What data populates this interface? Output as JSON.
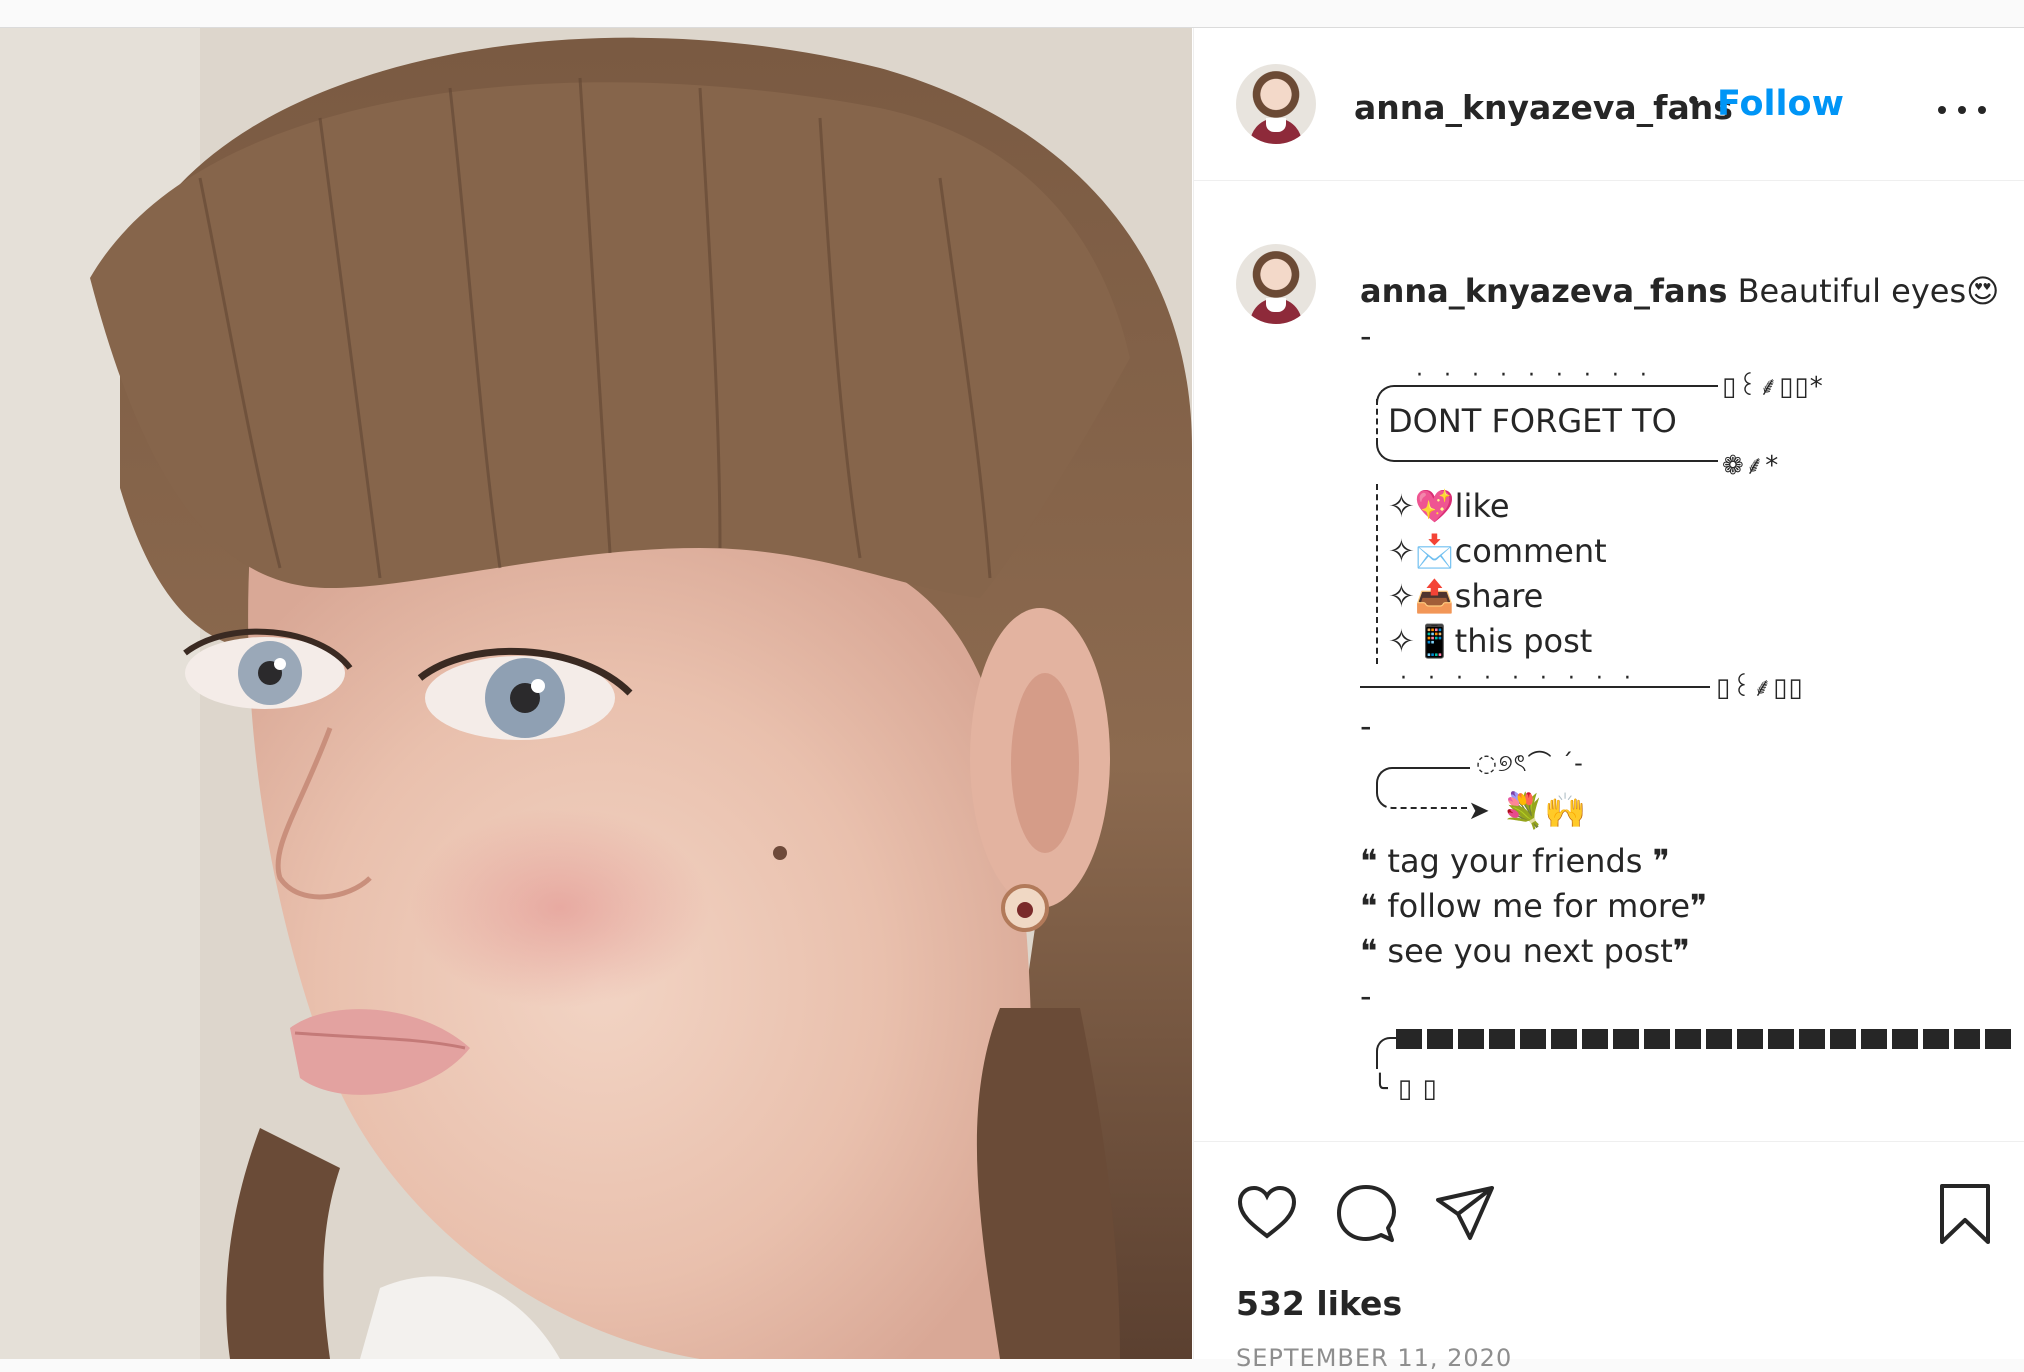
{
  "post": {
    "photo_alt": "",
    "author": "anna_knyazeva_fans",
    "separator": "•",
    "follow_label": "Follow",
    "more_icon": "more-horizontal-icon"
  },
  "caption": {
    "username": "anna_knyazeva_fans",
    "text": "Beautiful eyes😍",
    "dash1": "-",
    "deco_dots": "· · ·   · · ·   · · ·",
    "deco_tail_top": "▯꒰⸙▯▯*",
    "dont_forget": "DONT FORGET TO",
    "deco_tail_mid": "❁⸙*",
    "items": [
      {
        "prefix": "✧💖",
        "label": "like"
      },
      {
        "prefix": "✧📩",
        "label": "comment"
      },
      {
        "prefix": "✧📤",
        "label": "share"
      },
      {
        "prefix": "✧📱",
        "label": "this post"
      }
    ],
    "deco_tail_bottom": "▯꒰⸙▯▯",
    "dash2": "-",
    "swirl": "◌୭ৎ⌒ ˊ-",
    "arrow_head": "➤",
    "flowers": "💐🙌",
    "quotes": [
      "❝ tag your friends ❞",
      "❝ follow me for more❞",
      "❝ see you next post❞"
    ],
    "dash3": "-",
    "partial": "╰ ▯                                  ▯"
  },
  "actions": {
    "like_icon": "heart-icon",
    "comment_icon": "comment-icon",
    "share_icon": "send-icon",
    "save_icon": "bookmark-icon",
    "likes_text": "532 likes",
    "date_text": "SEPTEMBER 11, 2020"
  }
}
